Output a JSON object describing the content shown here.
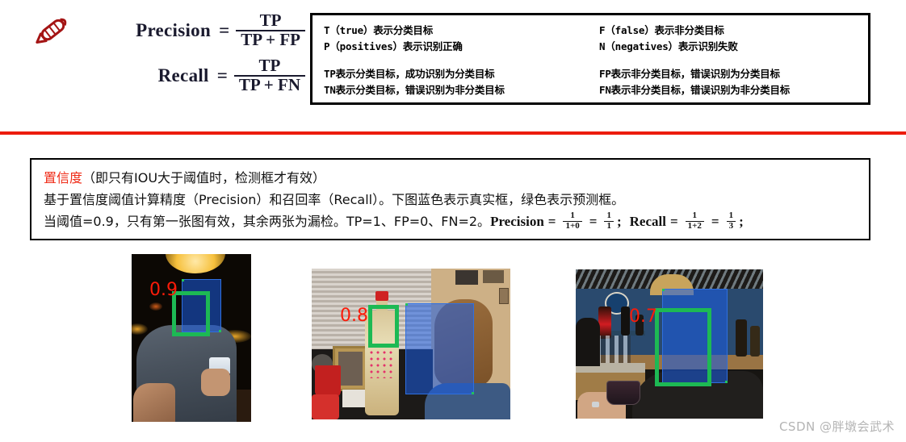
{
  "formulas": {
    "precision": {
      "label": "Precision",
      "equals": "=",
      "numerator": "TP",
      "denominator": "TP + FP"
    },
    "recall": {
      "label": "Recall",
      "equals": "=",
      "numerator": "TP",
      "denominator": "TP + FN"
    },
    "icon": "pencil-icon"
  },
  "definitions": {
    "left": {
      "line1": "T（true）表示分类目标",
      "line2": "P（positives）表示识别正确",
      "line3": "TP表示分类目标，成功识别为分类目标",
      "line4": "TN表示分类目标，错误识别为非分类目标"
    },
    "right": {
      "line1": "F（false）表示非分类目标",
      "line2": "N（negatives）表示识别失败",
      "line3": "FP表示非分类目标，错误识别为分类目标",
      "line4": "FN表示非分类目标，错误识别为非分类目标"
    }
  },
  "divider_color": "#ec1c0c",
  "confidence": {
    "title_red": "置信度",
    "title_rest": "（即只有IOU大于阈值时，检测框才有效）",
    "line2": "基于置信度阈值计算精度（Precision）和召回率（Recall）。下图蓝色表示真实框，绿色表示预测框。",
    "line3_prefix": "当阈值=0.9，只有第一张图有效，其余两张为漏检。TP=1、FP=0、FN=2。",
    "precision_word": "Precision",
    "precision_eq1": "=",
    "precision_frac1_num": "1",
    "precision_frac1_den": "1+0",
    "precision_eq2": "=",
    "precision_frac2_num": "1",
    "precision_frac2_den": "1",
    "semicolon1": ";",
    "recall_word": "Recall",
    "recall_eq1": "=",
    "recall_frac1_num": "1",
    "recall_frac1_den": "1+2",
    "recall_eq2": "=",
    "recall_frac2_num": "1",
    "recall_frac2_den": "3",
    "semicolon2": ";"
  },
  "photos": [
    {
      "id": "photo-1",
      "confidence": "0.9",
      "ground_truth_box": "blue",
      "predicted_box": "green"
    },
    {
      "id": "photo-2",
      "confidence": "0.8",
      "ground_truth_box": "blue",
      "predicted_box": "green"
    },
    {
      "id": "photo-3",
      "confidence": "0.7",
      "ground_truth_box": "blue",
      "predicted_box": "green"
    }
  ],
  "colors": {
    "ground_truth_blue": "#1a5ce6",
    "prediction_green": "#1db954",
    "confidence_red": "#fb1b09",
    "divider_red": "#ec1c0c",
    "heading_red": "#ef2b17"
  },
  "watermark": "CSDN @胖墩会武术"
}
